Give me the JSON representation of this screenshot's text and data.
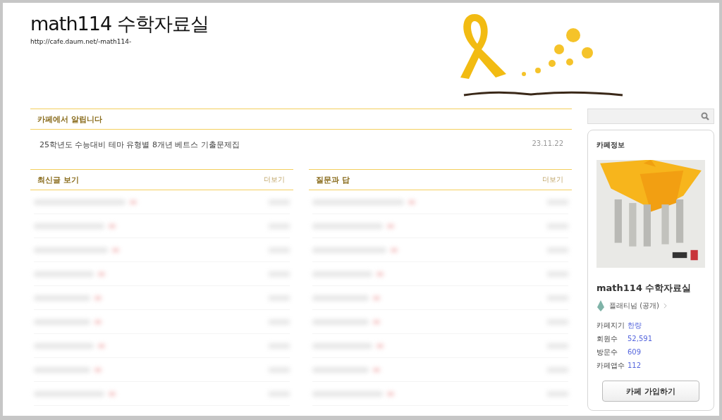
{
  "header": {
    "title": "math114 수학자료실",
    "url": "http://cafe.daum.net/-math114-"
  },
  "notice": {
    "title": "카페에서 알립니다",
    "items": [
      {
        "title": "25학년도 수능대비 테마 유형별 8개년 베트스 기출문제집",
        "date": "23.11.22"
      }
    ]
  },
  "boards": [
    {
      "title": "최신글 보기",
      "more": "더보기"
    },
    {
      "title": "질문과 답",
      "more": "더보기"
    }
  ],
  "sidebar": {
    "info": {
      "heading": "카페정보",
      "name": "math114 수학자료실",
      "grade": "플래티넘 (공개)",
      "stats": [
        {
          "label": "카페지기",
          "value": "한량"
        },
        {
          "label": "회원수",
          "value": "52,591"
        },
        {
          "label": "방문수",
          "value": "609"
        },
        {
          "label": "카페앱수",
          "value": "112"
        }
      ],
      "join": "카페 가입하기"
    }
  }
}
